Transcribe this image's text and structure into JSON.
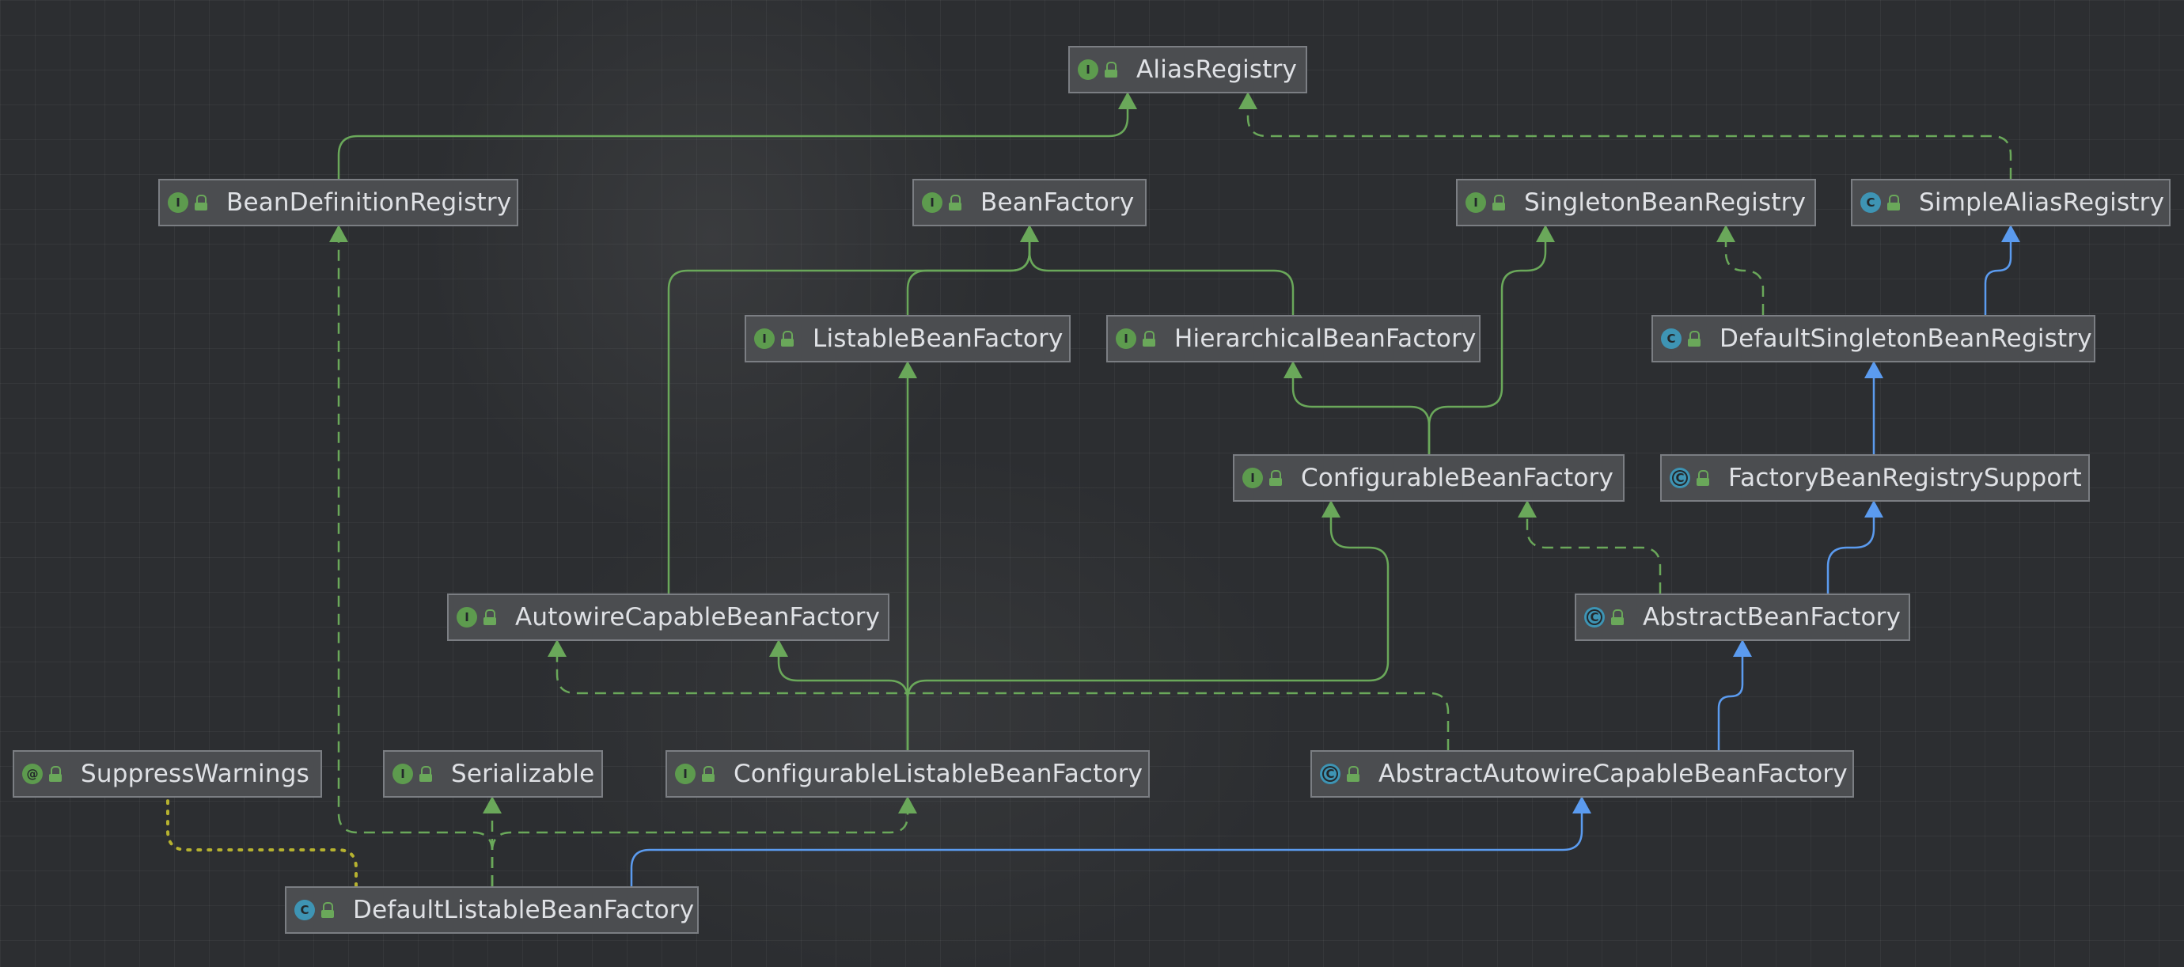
{
  "diagram": {
    "nodes": [
      {
        "id": "AliasRegistry",
        "label": "AliasRegistry",
        "kind": "interface",
        "kind_letter": "I"
      },
      {
        "id": "BeanDefinitionRegistry",
        "label": "BeanDefinitionRegistry",
        "kind": "interface",
        "kind_letter": "I"
      },
      {
        "id": "BeanFactory",
        "label": "BeanFactory",
        "kind": "interface",
        "kind_letter": "I"
      },
      {
        "id": "SingletonBeanRegistry",
        "label": "SingletonBeanRegistry",
        "kind": "interface",
        "kind_letter": "I"
      },
      {
        "id": "SimpleAliasRegistry",
        "label": "SimpleAliasRegistry",
        "kind": "class",
        "kind_letter": "C"
      },
      {
        "id": "ListableBeanFactory",
        "label": "ListableBeanFactory",
        "kind": "interface",
        "kind_letter": "I"
      },
      {
        "id": "HierarchicalBeanFactory",
        "label": "HierarchicalBeanFactory",
        "kind": "interface",
        "kind_letter": "I"
      },
      {
        "id": "DefaultSingletonBeanRegistry",
        "label": "DefaultSingletonBeanRegistry",
        "kind": "class",
        "kind_letter": "C"
      },
      {
        "id": "ConfigurableBeanFactory",
        "label": "ConfigurableBeanFactory",
        "kind": "interface",
        "kind_letter": "I"
      },
      {
        "id": "FactoryBeanRegistrySupport",
        "label": "FactoryBeanRegistrySupport",
        "kind": "abstract",
        "kind_letter": "C"
      },
      {
        "id": "AutowireCapableBeanFactory",
        "label": "AutowireCapableBeanFactory",
        "kind": "interface",
        "kind_letter": "I"
      },
      {
        "id": "AbstractBeanFactory",
        "label": "AbstractBeanFactory",
        "kind": "abstract",
        "kind_letter": "C"
      },
      {
        "id": "SuppressWarnings",
        "label": "SuppressWarnings",
        "kind": "annotation",
        "kind_letter": "@"
      },
      {
        "id": "Serializable",
        "label": "Serializable",
        "kind": "interface",
        "kind_letter": "I"
      },
      {
        "id": "ConfigurableListableBeanFactory",
        "label": "ConfigurableListableBeanFactory",
        "kind": "interface",
        "kind_letter": "I"
      },
      {
        "id": "AbstractAutowireCapableBeanFactory",
        "label": "AbstractAutowireCapableBeanFactory",
        "kind": "abstract",
        "kind_letter": "C"
      },
      {
        "id": "DefaultListableBeanFactory",
        "label": "DefaultListableBeanFactory",
        "kind": "class",
        "kind_letter": "C"
      }
    ],
    "edges": [
      {
        "from": "BeanDefinitionRegistry",
        "to": "AliasRegistry",
        "relation": "extends-interface"
      },
      {
        "from": "SimpleAliasRegistry",
        "to": "AliasRegistry",
        "relation": "implements"
      },
      {
        "from": "ListableBeanFactory",
        "to": "BeanFactory",
        "relation": "extends-interface"
      },
      {
        "from": "HierarchicalBeanFactory",
        "to": "BeanFactory",
        "relation": "extends-interface"
      },
      {
        "from": "AutowireCapableBeanFactory",
        "to": "BeanFactory",
        "relation": "extends-interface"
      },
      {
        "from": "DefaultSingletonBeanRegistry",
        "to": "SingletonBeanRegistry",
        "relation": "implements"
      },
      {
        "from": "DefaultSingletonBeanRegistry",
        "to": "SimpleAliasRegistry",
        "relation": "extends-class"
      },
      {
        "from": "ConfigurableBeanFactory",
        "to": "HierarchicalBeanFactory",
        "relation": "extends-interface"
      },
      {
        "from": "ConfigurableBeanFactory",
        "to": "SingletonBeanRegistry",
        "relation": "extends-interface"
      },
      {
        "from": "FactoryBeanRegistrySupport",
        "to": "DefaultSingletonBeanRegistry",
        "relation": "extends-class"
      },
      {
        "from": "AbstractBeanFactory",
        "to": "ConfigurableBeanFactory",
        "relation": "implements"
      },
      {
        "from": "AbstractBeanFactory",
        "to": "FactoryBeanRegistrySupport",
        "relation": "extends-class"
      },
      {
        "from": "ConfigurableListableBeanFactory",
        "to": "ListableBeanFactory",
        "relation": "extends-interface"
      },
      {
        "from": "ConfigurableListableBeanFactory",
        "to": "AutowireCapableBeanFactory",
        "relation": "extends-interface"
      },
      {
        "from": "ConfigurableListableBeanFactory",
        "to": "ConfigurableBeanFactory",
        "relation": "extends-interface"
      },
      {
        "from": "AbstractAutowireCapableBeanFactory",
        "to": "AutowireCapableBeanFactory",
        "relation": "implements"
      },
      {
        "from": "AbstractAutowireCapableBeanFactory",
        "to": "AbstractBeanFactory",
        "relation": "extends-class"
      },
      {
        "from": "DefaultListableBeanFactory",
        "to": "AbstractAutowireCapableBeanFactory",
        "relation": "extends-class"
      },
      {
        "from": "DefaultListableBeanFactory",
        "to": "ConfigurableListableBeanFactory",
        "relation": "implements"
      },
      {
        "from": "DefaultListableBeanFactory",
        "to": "BeanDefinitionRegistry",
        "relation": "implements"
      },
      {
        "from": "DefaultListableBeanFactory",
        "to": "Serializable",
        "relation": "implements"
      },
      {
        "from": "DefaultListableBeanFactory",
        "to": "SuppressWarnings",
        "relation": "annotated-with"
      }
    ]
  },
  "colors": {
    "interface_edge": "#6aa85a",
    "class_edge": "#5b9bef",
    "annotation_edge": "#b6b230",
    "interface_badge": "#5d9b4e",
    "class_badge": "#3e94b4",
    "node_bg": "#4b4d50",
    "node_border": "#7b7e83",
    "text": "#dfe1e5"
  }
}
